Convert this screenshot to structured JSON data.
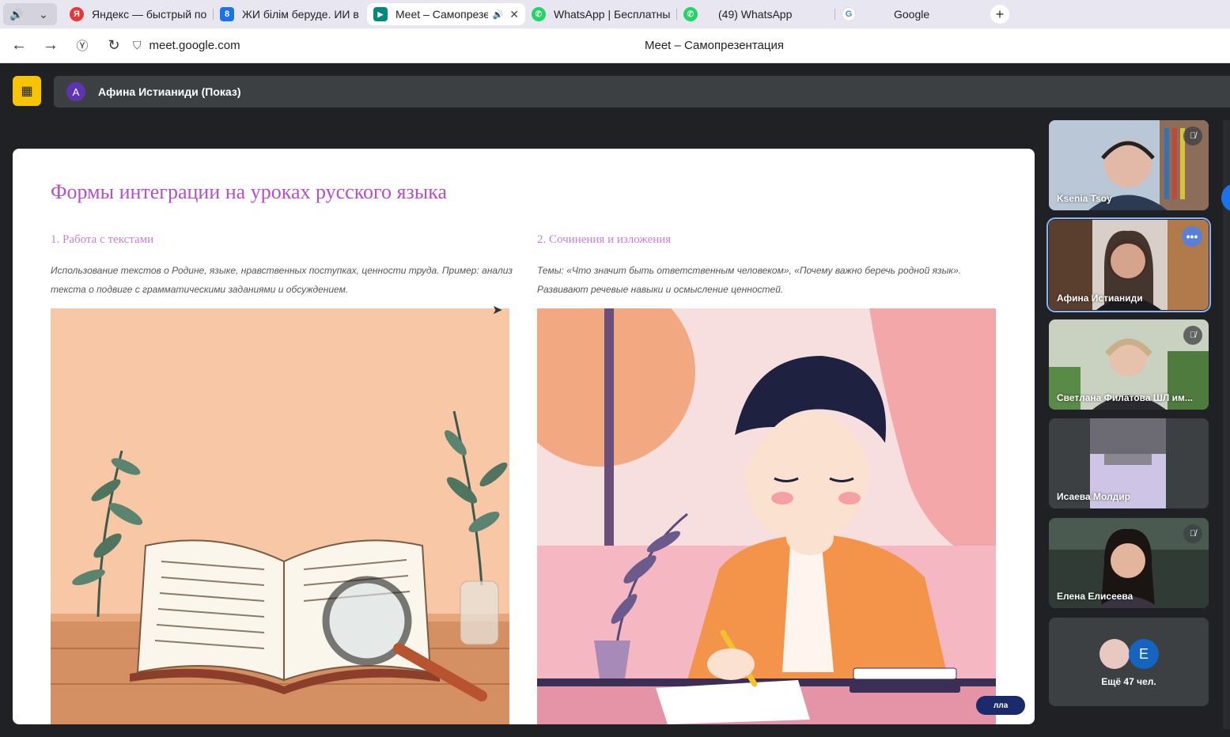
{
  "browser": {
    "tabs": [
      {
        "title": "Яндекс — быстрый поиск",
        "favicon": "yandex-icon",
        "favicon_letter": "Я",
        "favicon_color": "#e53935",
        "active": false
      },
      {
        "title": "ЖИ білім беруде. ИИ в об",
        "favicon": "calendar-icon",
        "favicon_letter": "8",
        "favicon_color": "#1a73e8",
        "active": false
      },
      {
        "title": "Meet – Самопрезен",
        "favicon": "meet-icon",
        "favicon_letter": "▶",
        "favicon_color": "#00897b",
        "active": true
      },
      {
        "title": "WhatsApp | Бесплатный з",
        "favicon": "whatsapp-icon",
        "favicon_letter": "✆",
        "favicon_color": "#25d366",
        "active": false
      },
      {
        "title": "(49) WhatsApp",
        "favicon": "whatsapp-icon",
        "favicon_letter": "✆",
        "favicon_color": "#25d366",
        "active": false
      },
      {
        "title": "Google",
        "favicon": "google-icon",
        "favicon_letter": "G",
        "favicon_color": "#4285f4",
        "active": false
      }
    ],
    "url": "meet.google.com",
    "page_title": "Meet – Самопрезентация"
  },
  "meet": {
    "presenter_initial": "A",
    "presenter_label": "Афина Истианиди (Показ)",
    "accent": "#f6c400"
  },
  "slide": {
    "title": "Формы интеграции на уроках русского языка",
    "columns": [
      {
        "heading": "1. Работа с текстами",
        "text": "Использование текстов о Родине, языке, нравственных поступках, ценности труда. Пример: анализ текста о подвиге с грамматическими заданиями и обсуждением."
      },
      {
        "heading": "2. Сочинения и изложения",
        "text": "Темы: «Что значит быть ответственным человеком», «Почему важно беречь родной язык». Развивают речевые навыки и осмысление ценностей."
      }
    ],
    "pill_text": "лла"
  },
  "participants": [
    {
      "name": "Ksenia Tsoy",
      "muted": true,
      "more_menu": false,
      "highlight": false
    },
    {
      "name": "Афина Истианиди",
      "muted": false,
      "more_menu": true,
      "highlight": true
    },
    {
      "name": "Светлана Филатова ШЛ им...",
      "muted": true,
      "more_menu": false,
      "highlight": false
    },
    {
      "name": "Исаева Молдир",
      "muted": false,
      "more_menu": false,
      "highlight": false
    },
    {
      "name": "Елена Елисеева",
      "muted": true,
      "more_menu": false,
      "highlight": false
    }
  ],
  "more_participants": {
    "avatar_letter": "E",
    "label": "Ещё 47 чел."
  }
}
